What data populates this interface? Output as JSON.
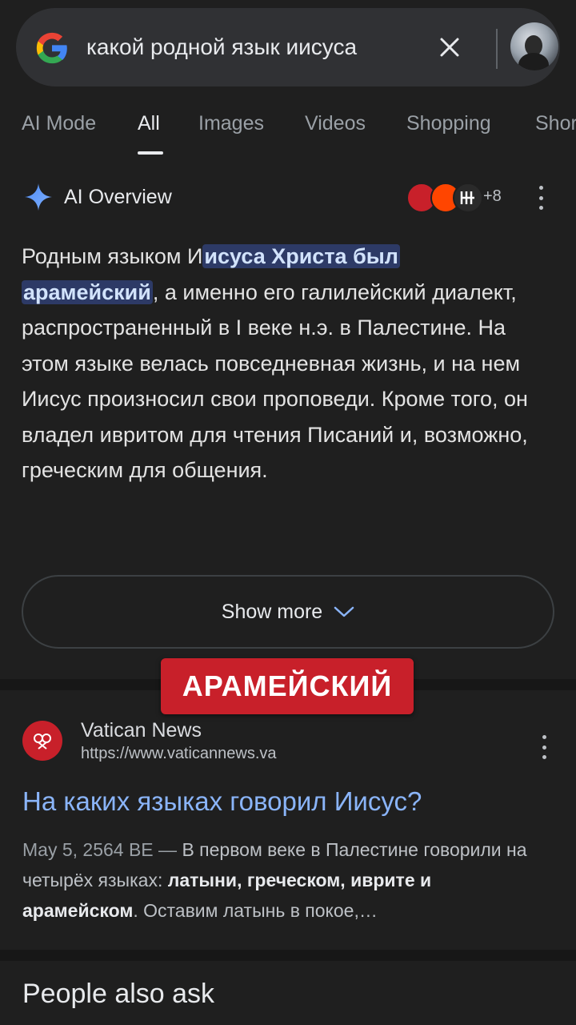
{
  "search": {
    "query": "какой родной язык иисуса"
  },
  "tabs": [
    "AI Mode",
    "All",
    "Images",
    "Videos",
    "Shopping",
    "Shor"
  ],
  "active_tab": "All",
  "ai_overview": {
    "title": "AI Overview",
    "source_count": "+8",
    "text_before": "Родным языком И",
    "text_highlight_1": "исуса Христа был",
    "text_highlight_2": "арамейский",
    "text_after": ", а именно его галилейский диалект, распространенный в I веке н.э. в Палестине. На этом языке велась повседневная жизнь, и на нем Иисус произносил свои проповеди. Кроме того, он владел ивритом для чтения Писаний и, возможно, греческим для общения.",
    "show_more": "Show more"
  },
  "caption": "АРАМЕЙСКИЙ",
  "result": {
    "site": "Vatican News",
    "url": "https://www.vaticannews.va",
    "title": "На каких языках говорил Иисус?",
    "date": "May 5, 2564 BE",
    "dash": " — ",
    "snippet_1": "В первом веке в Палестине говорили на четырёх языках: ",
    "snippet_bold": "латыни, греческом, иврите и арамейском",
    "snippet_2": ". Оставим латынь в покое,…"
  },
  "people_also_ask": "People also ask",
  "colors": {
    "background": "#1f1f1f",
    "link": "#8ab4f8",
    "highlight": "#2d3a66",
    "caption_bg": "#c8202a"
  }
}
